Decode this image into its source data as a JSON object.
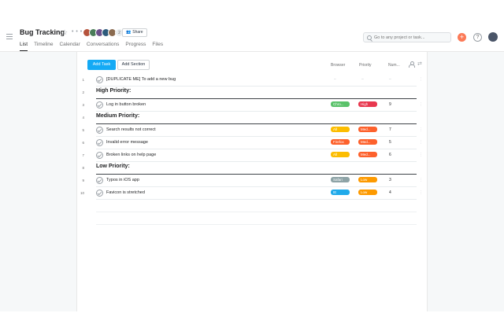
{
  "project": {
    "title": "Bug Tracking",
    "more": "• • •",
    "avatar_count": "2",
    "share_label": "Share"
  },
  "tabs": [
    "List",
    "Timeline",
    "Calendar",
    "Conversations",
    "Progress",
    "Files"
  ],
  "search": {
    "placeholder": "Go to any project or task..."
  },
  "toolbar": {
    "add_task_label": "Add Task",
    "add_section_label": "Add Section",
    "columns": {
      "browser": "Browser",
      "priority": "Priority",
      "number": "Num..."
    }
  },
  "rows": [
    {
      "num": "1",
      "kind": "task",
      "name": "[DUPLICATE ME] To add a new bug",
      "browser": "",
      "priority": "",
      "number": ""
    },
    {
      "num": "2",
      "kind": "section",
      "name": "High Priority:"
    },
    {
      "num": "3",
      "kind": "task",
      "name": "Log in button broken",
      "browser": "Chro...",
      "browser_color": "#5ac26a",
      "priority": "High",
      "priority_color": "#e8384f",
      "number": "9"
    },
    {
      "num": "4",
      "kind": "section",
      "name": "Medium Priority:"
    },
    {
      "num": "5",
      "kind": "task",
      "name": "Search results not correct",
      "browser": "All",
      "browser_color": "#fcbd01",
      "priority": "Med...",
      "priority_color": "#fd612c",
      "number": "7"
    },
    {
      "num": "6",
      "kind": "task",
      "name": "Invalid error message",
      "browser": "Firefox",
      "browser_color": "#fd612c",
      "priority": "Med...",
      "priority_color": "#fd612c",
      "number": "5"
    },
    {
      "num": "7",
      "kind": "task",
      "name": "Broken links on help page",
      "browser": "All",
      "browser_color": "#fcbd01",
      "priority": "Med...",
      "priority_color": "#fd612c",
      "number": "6"
    },
    {
      "num": "8",
      "kind": "section",
      "name": "Low Priority:"
    },
    {
      "num": "9",
      "kind": "task",
      "name": "Typos in iOS app",
      "browser": "Safari",
      "browser_color": "#8da3a6",
      "priority": "Low",
      "priority_color": "#fd9a00",
      "number": "3"
    },
    {
      "num": "10",
      "kind": "task",
      "name": "Favicon is stretched",
      "browser": "IE",
      "browser_color": "#20aaea",
      "priority": "Low",
      "priority_color": "#fd9a00",
      "number": "4"
    }
  ],
  "colors": {
    "accent": "#14aaf5",
    "add_button": "#fc7a57"
  }
}
